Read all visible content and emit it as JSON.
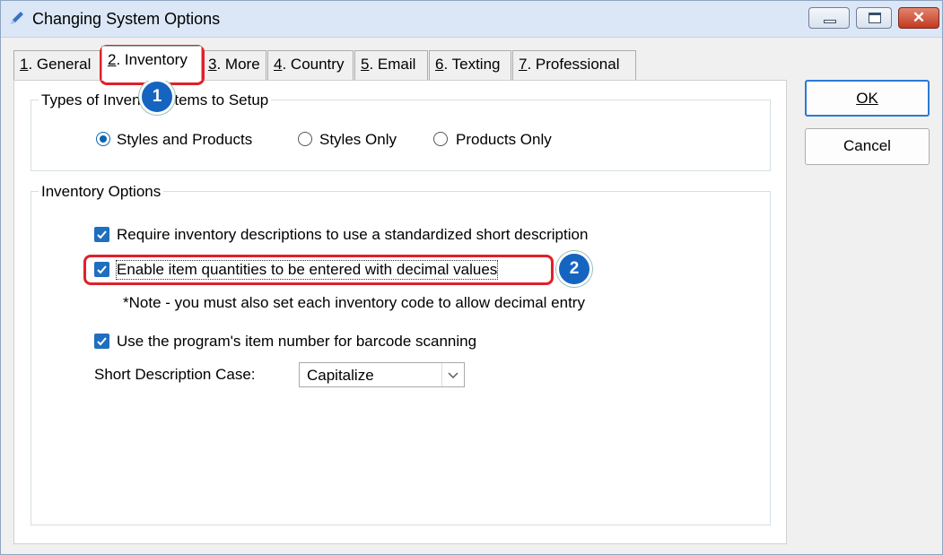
{
  "window": {
    "title": "Changing System Options",
    "close_glyph": "✕"
  },
  "tabs": [
    {
      "num": "1",
      "label": ". General"
    },
    {
      "num": "2",
      "label": ". Inventory"
    },
    {
      "num": "3",
      "label": ". More"
    },
    {
      "num": "4",
      "label": ". Country"
    },
    {
      "num": "5",
      "label": ". Email"
    },
    {
      "num": "6",
      "label": ". Texting"
    },
    {
      "num": "7",
      "label": ". Professional"
    }
  ],
  "types_group": {
    "legend": "Types of Inventory Items to Setup",
    "options": [
      "Styles and Products",
      "Styles Only",
      "Products Only"
    ],
    "selected": "Styles and Products"
  },
  "options_group": {
    "legend": "Inventory Options",
    "require_desc": "Require inventory descriptions to use a standardized short description",
    "decimal": "Enable item quantities to be entered with decimal values",
    "note": "*Note - you must also set each inventory code to allow decimal entry",
    "barcode": "Use the program's item number for barcode scanning",
    "short_case_label": "Short Description Case:",
    "short_case_value": "Capitalize"
  },
  "buttons": {
    "ok": "OK",
    "cancel": "Cancel"
  },
  "callouts": {
    "one": "1",
    "two": "2"
  },
  "colors": {
    "accent": "#1565c0",
    "highlight": "#e0202a",
    "checkbox": "#1f6fbf"
  }
}
